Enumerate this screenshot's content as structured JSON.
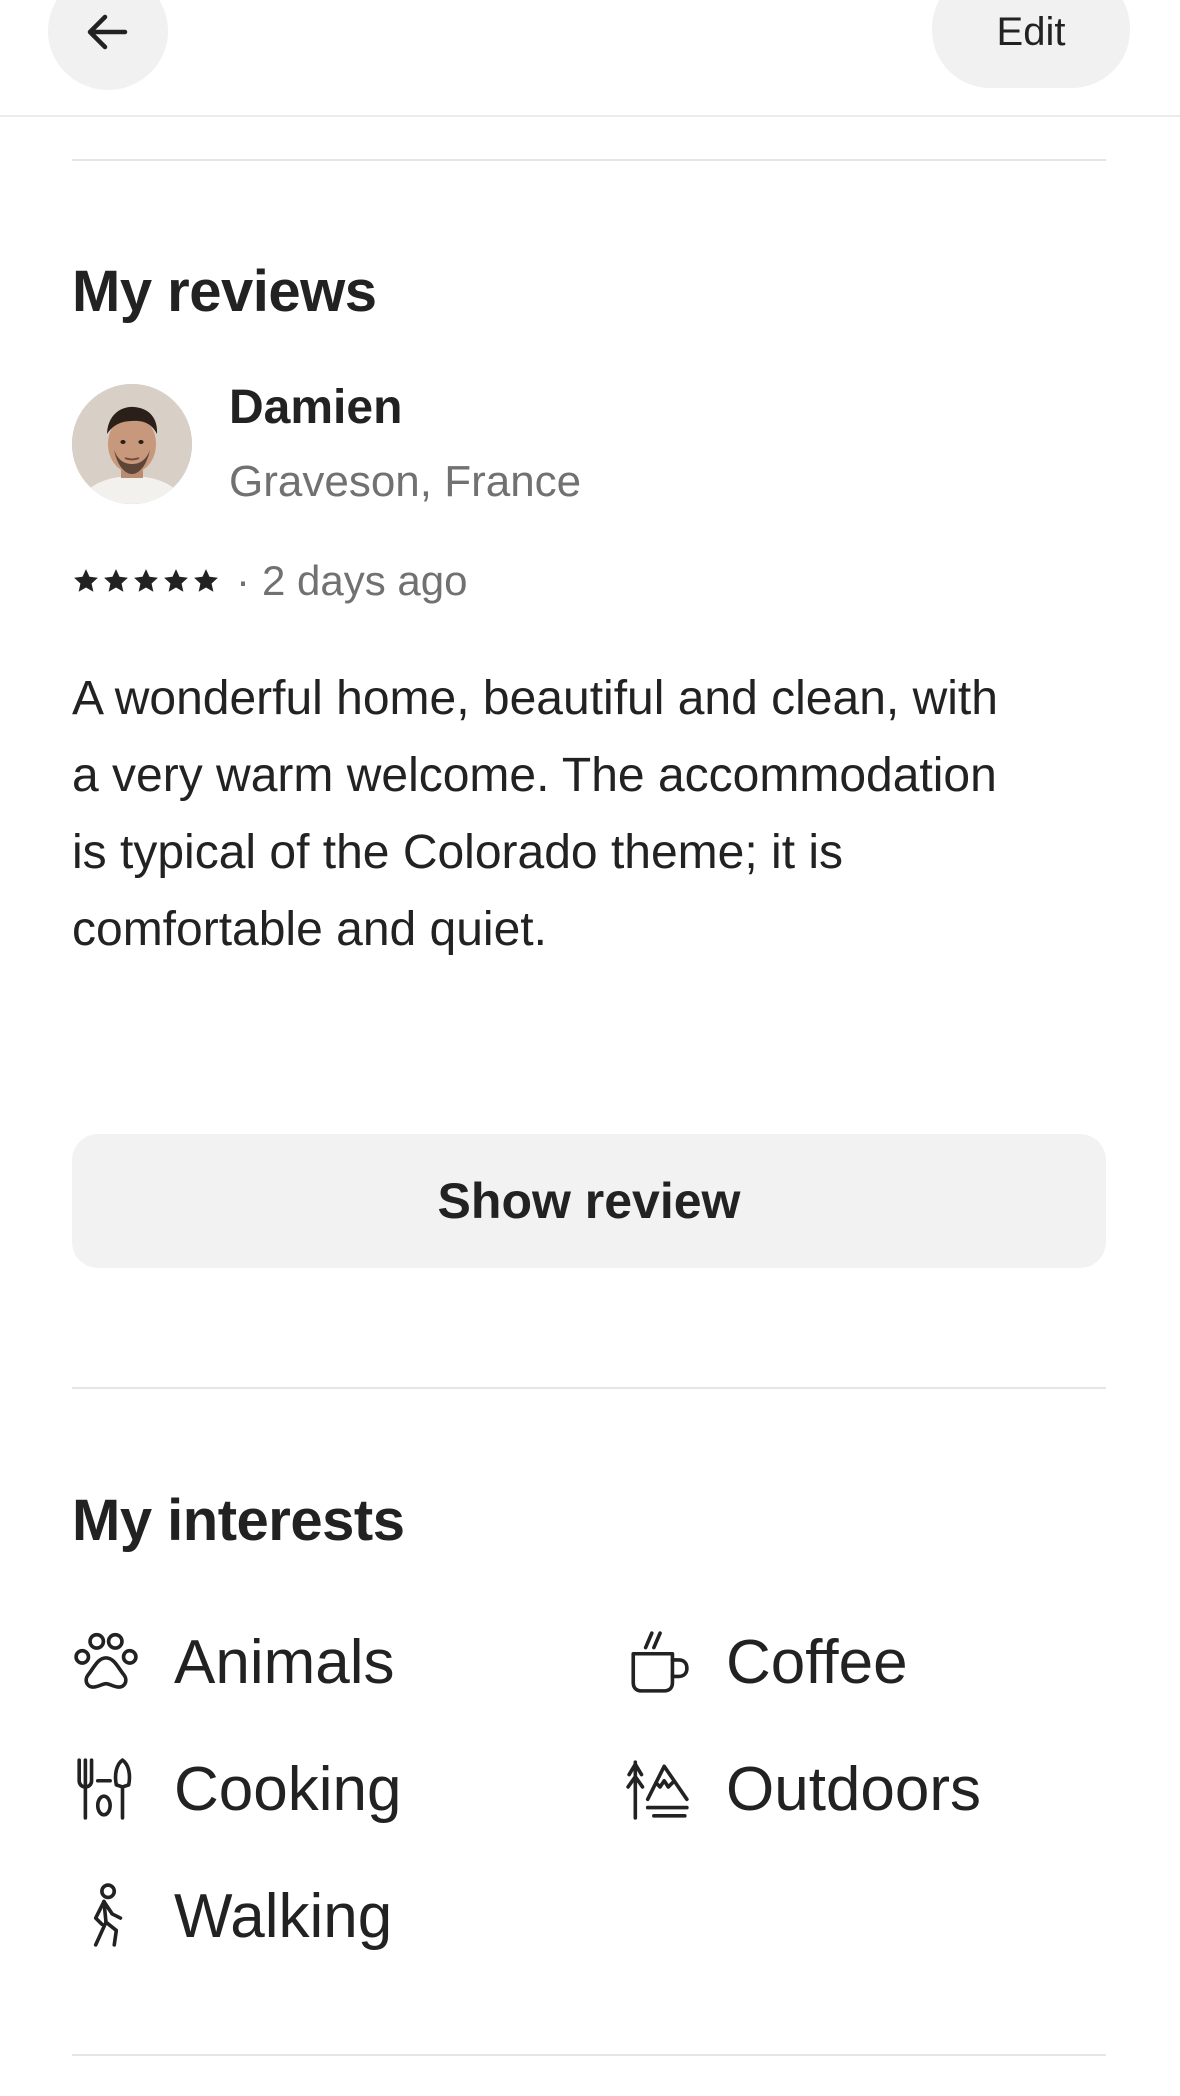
{
  "header": {
    "back_icon": "arrow-left-icon",
    "edit_label": "Edit"
  },
  "reviews": {
    "title": "My reviews",
    "items": [
      {
        "name": "Damien",
        "location": "Graveson, France",
        "rating": 5,
        "separator": "·",
        "time_ago": "2 days ago",
        "text": "A wonderful home, beautiful and clean, with a very warm welcome. The accommodation is typical of the Colorado theme; it is comfortable and quiet."
      }
    ],
    "show_button_label": "Show review"
  },
  "interests": {
    "title": "My interests",
    "items": [
      {
        "label": "Animals",
        "icon": "paw-icon"
      },
      {
        "label": "Coffee",
        "icon": "coffee-cup-icon"
      },
      {
        "label": "Cooking",
        "icon": "cooking-utensils-icon"
      },
      {
        "label": "Outdoors",
        "icon": "mountain-icon"
      },
      {
        "label": "Walking",
        "icon": "walking-person-icon"
      }
    ]
  }
}
